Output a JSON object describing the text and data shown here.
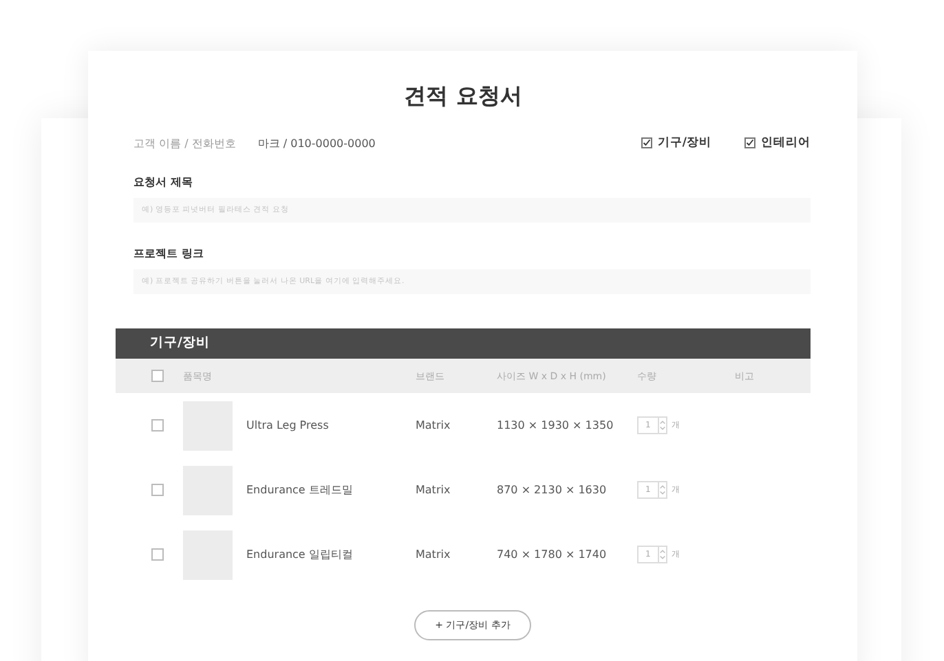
{
  "title": "견적 요청서",
  "customer": {
    "label": "고객 이름 / 전화번호",
    "value": "마크 / 010-0000-0000"
  },
  "categories": [
    {
      "label": "기구/장비",
      "checked": true
    },
    {
      "label": "인테리어",
      "checked": true
    }
  ],
  "fields": [
    {
      "label": "요청서 제목",
      "placeholder": "예) 영등포 피넛버터 필라테스 견적 요청"
    },
    {
      "label": "프로젝트 링크",
      "placeholder": "예) 프로젝트 공유하기 버튼을 눌러서 나온 URL을 여기에 입력해주세요."
    }
  ],
  "section": {
    "title": "기구/장비",
    "columns": [
      "품목명",
      "브랜드",
      "사이즈 W x D x H (mm)",
      "수량",
      "비고"
    ],
    "header_checked": false,
    "rows": [
      {
        "checked": false,
        "name": "Ultra Leg Press",
        "brand": "Matrix",
        "size": "1130 × 1930 × 1350",
        "qty": "1",
        "unit": "개"
      },
      {
        "checked": false,
        "name": "Endurance 트레드밀",
        "brand": "Matrix",
        "size": "870 × 2130 × 1630",
        "qty": "1",
        "unit": "개"
      },
      {
        "checked": false,
        "name": "Endurance 일립티컬",
        "brand": "Matrix",
        "size": "740 × 1780 × 1740",
        "qty": "1",
        "unit": "개"
      }
    ],
    "add_button": "+ 기구/장비 추가"
  }
}
